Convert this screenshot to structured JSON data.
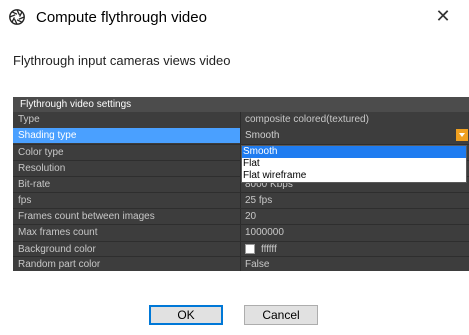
{
  "window": {
    "title": "Compute flythrough video",
    "close_glyph": "✕"
  },
  "description": "Flythrough input cameras views video",
  "settings": {
    "header": "Flythrough video settings",
    "rows": [
      {
        "name": "Type",
        "value": "composite colored(textured)"
      },
      {
        "name": "Shading type",
        "value": "Smooth"
      },
      {
        "name": "Color type",
        "value": ""
      },
      {
        "name": "Resolution",
        "value": ""
      },
      {
        "name": "Bit-rate",
        "value": "8000 Kbps"
      },
      {
        "name": "fps",
        "value": "25 fps"
      },
      {
        "name": "Frames count between images",
        "value": "20"
      },
      {
        "name": "Max frames count",
        "value": "1000000"
      },
      {
        "name": "Background color",
        "value": "ffffff",
        "swatch_color": "#ffffff"
      },
      {
        "name": "Random part color",
        "value": "False"
      }
    ]
  },
  "shading_dropdown": {
    "options": [
      "Smooth",
      "Flat",
      "Flat wireframe"
    ],
    "selected": "Smooth"
  },
  "buttons": {
    "ok": "OK",
    "cancel": "Cancel"
  },
  "colors": {
    "selection": "#4aa0ff",
    "dropdown_arrow": "#f0a020",
    "panel_bg": "#3d3d3d",
    "ok_border": "#0078d7"
  }
}
